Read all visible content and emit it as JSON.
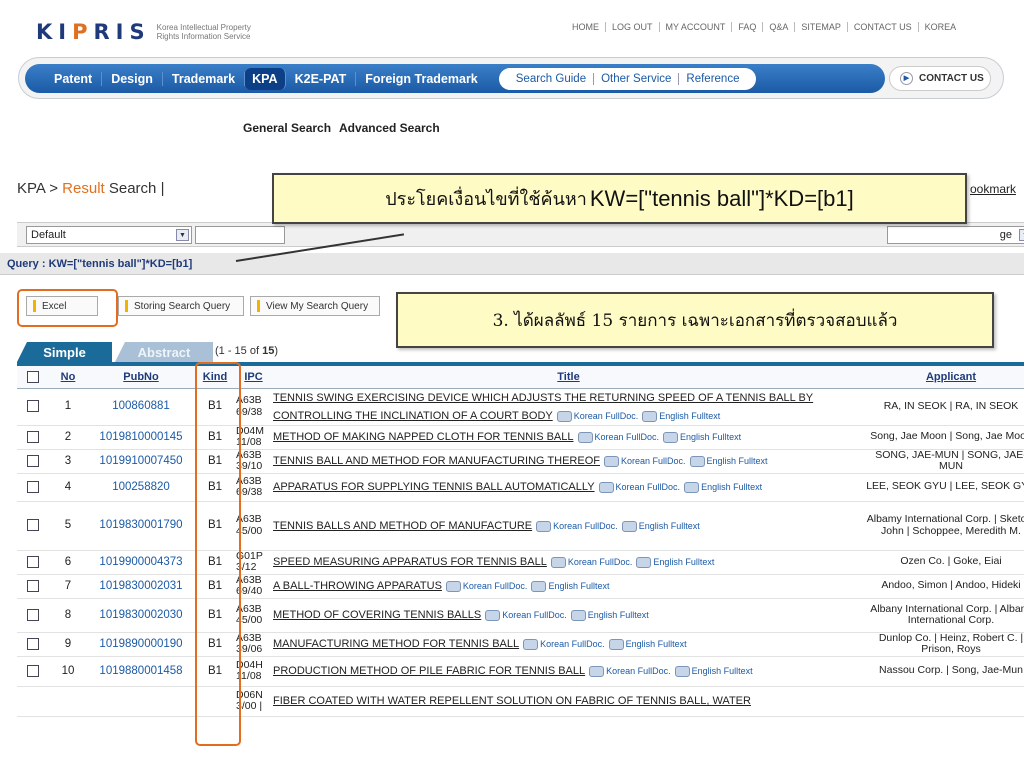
{
  "logo": {
    "mark": "KIPRIS",
    "sub1": "Korea Intellectual Property",
    "sub2": "Rights Information Service"
  },
  "topnav": [
    "HOME",
    "LOG OUT",
    "MY ACCOUNT",
    "FAQ",
    "Q&A",
    "SITEMAP",
    "CONTACT US",
    "KOREA"
  ],
  "mainnav": {
    "tabs": [
      "Patent",
      "Design",
      "Trademark",
      "KPA",
      "K2E-PAT",
      "Foreign Trademark"
    ],
    "pill": [
      "Search Guide",
      "Other Service",
      "Reference"
    ],
    "contact": "CONTACT US"
  },
  "subnav": [
    "General Search",
    "Advanced Search"
  ],
  "crumb": {
    "a": "KPA > ",
    "b": "Result",
    "c": " Search |"
  },
  "bookmark": "ookmark",
  "callout1": {
    "thai": "ประโยคเงื่อนไขที่ใช้ค้นหา",
    "query": "KW=[\"tennis ball\"]*KD=[b1]"
  },
  "callout2": "3. ได้ผลลัพธ์ 15 รายการ เฉพาะเอกสารที่ตรวจสอบแล้ว",
  "search": {
    "select": "Default",
    "select2": "ge"
  },
  "query": "Query : KW=[\"tennis ball\"]*KD=[b1]",
  "buttons": {
    "excel": "Excel",
    "storing": "Storing Search Query",
    "view": "View My Search Query"
  },
  "tabs": {
    "simple": "Simple",
    "abstract": "Abstract"
  },
  "count": {
    "pre": "(1 - 15 of ",
    "total": "15",
    "post": ")"
  },
  "columns": {
    "no": "No",
    "pubno": "PubNo",
    "kind": "Kind",
    "ipc": "IPC",
    "title": "Title",
    "applicant": "Applicant"
  },
  "fulltext": {
    "korean": "Korean FullDoc.",
    "english": "English Fulltext"
  },
  "rows": [
    {
      "no": "1",
      "pubno": "100860881",
      "kind": "B1",
      "ipc": "A63B 69/38",
      "title": "TENNIS SWING EXERCISING DEVICE WHICH ADJUSTS THE RETURNING SPEED OF A TENNIS BALL BY CONTROLLING THE INCLINATION OF A COURT BODY",
      "applicant": "RA, IN SEOK | RA, IN SEOK"
    },
    {
      "no": "2",
      "pubno": "1019810000145",
      "kind": "B1",
      "ipc": "D04M 11/08",
      "title": "METHOD OF MAKING NAPPED CLOTH FOR TENNIS BALL",
      "applicant": "Song, Jae Moon | Song, Jae Moon"
    },
    {
      "no": "3",
      "pubno": "1019910007450",
      "kind": "B1",
      "ipc": "A63B 39/10",
      "title": "TENNIS BALL AND METHOD FOR MANUFACTURING THEREOF",
      "applicant": "SONG, JAE-MUN | SONG, JAE-MUN"
    },
    {
      "no": "4",
      "pubno": "100258820",
      "kind": "B1",
      "ipc": "A63B 69/38",
      "title": "APPARATUS FOR SUPPLYING TENNIS BALL AUTOMATICALLY",
      "applicant": "LEE, SEOK GYU | LEE, SEOK GYU"
    },
    {
      "no": "5",
      "pubno": "1019830001790",
      "kind": "B1",
      "ipc": "A63B 45/00",
      "title": "TENNIS BALLS AND METHOD OF MANUFACTURE",
      "applicant": "Albamy International Corp. | Sketon, John | Schoppee, Meredith M."
    },
    {
      "no": "6",
      "pubno": "1019900004373",
      "kind": "B1",
      "ipc": "G01P 3/12",
      "title": "SPEED MEASURING APPARATUS FOR TENNIS BALL",
      "applicant": "Ozen Co. | Goke, Eiai"
    },
    {
      "no": "7",
      "pubno": "1019830002031",
      "kind": "B1",
      "ipc": "A63B 69/40",
      "title": "A BALL-THROWING APPARATUS",
      "applicant": "Andoo, Simon | Andoo, Hideki"
    },
    {
      "no": "8",
      "pubno": "1019830002030",
      "kind": "B1",
      "ipc": "A63B 45/00",
      "title": "METHOD OF COVERING TENNIS BALLS",
      "applicant": "Albany International Corp. | Albany International Corp."
    },
    {
      "no": "9",
      "pubno": "1019890000190",
      "kind": "B1",
      "ipc": "A63B 39/06",
      "title": "MANUFACTURING METHOD FOR TENNIS BALL",
      "applicant": "Dunlop Co. | Heinz, Robert C. | Prison, Roys"
    },
    {
      "no": "10",
      "pubno": "1019880001458",
      "kind": "B1",
      "ipc": "D04H 11/08",
      "title": "PRODUCTION METHOD OF PILE FABRIC FOR TENNIS BALL",
      "applicant": "Nassou Corp. | Song, Jae-Mun"
    },
    {
      "no": "",
      "pubno": "",
      "kind": "",
      "ipc": "D06N 3/00 |",
      "title": "FIBER COATED WITH WATER REPELLENT SOLUTION ON FABRIC OF TENNIS BALL, WATER",
      "applicant": ""
    }
  ]
}
